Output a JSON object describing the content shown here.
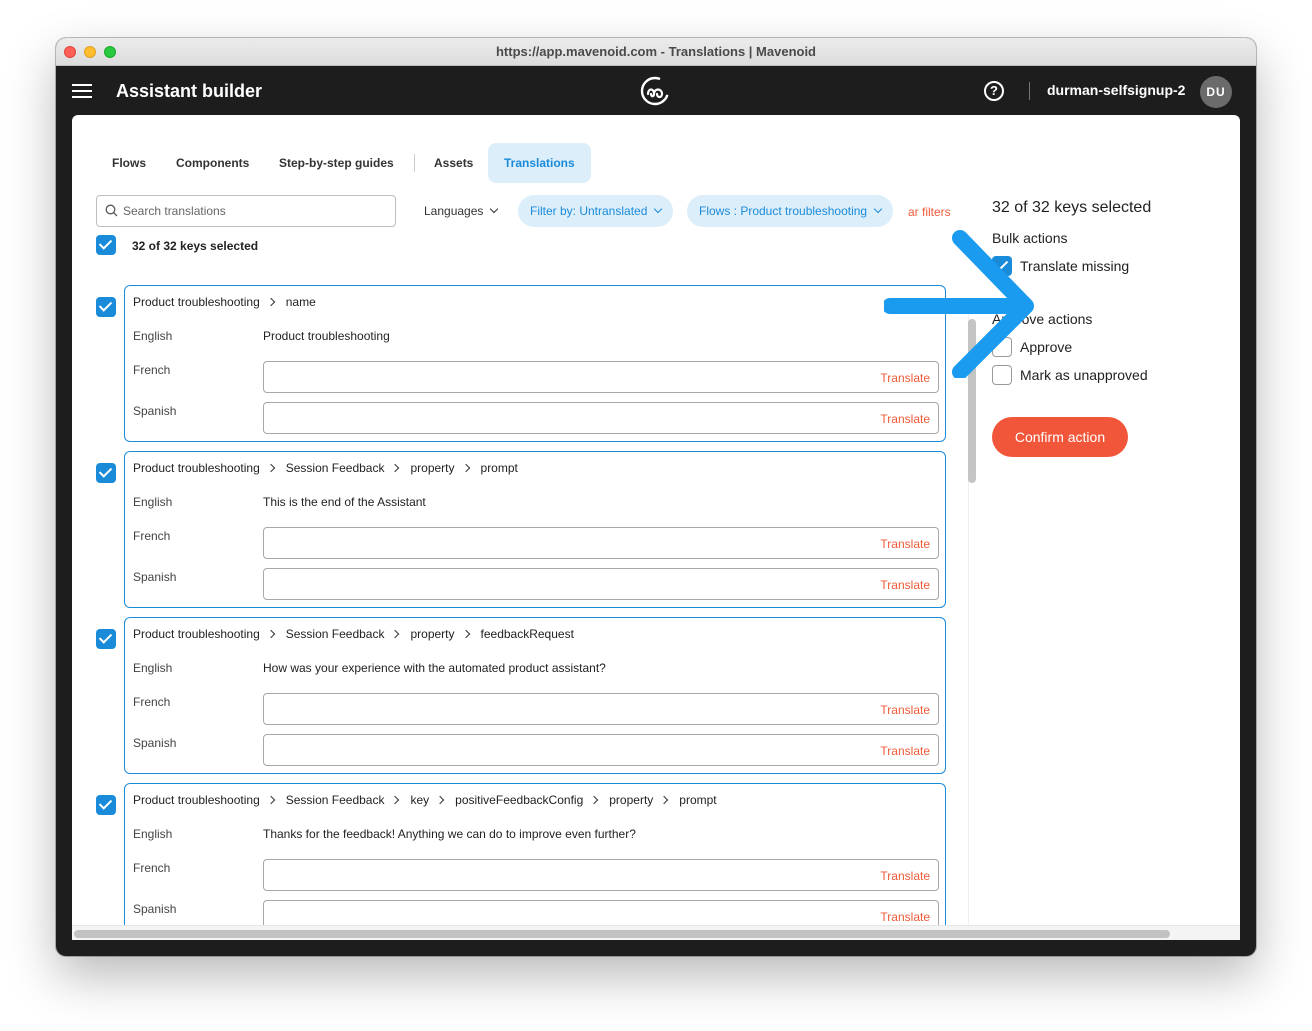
{
  "window": {
    "title": "https://app.mavenoid.com - Translations | Mavenoid"
  },
  "appbar": {
    "title": "Assistant builder",
    "username": "durman-selfsignup-2",
    "avatar_initials": "DU",
    "logo_icon": "mavenoid-logo-icon",
    "help_icon": "question-mark-icon"
  },
  "tabs": [
    {
      "label": "Flows"
    },
    {
      "label": "Components"
    },
    {
      "label": "Step-by-step guides"
    },
    {
      "label": "Assets"
    },
    {
      "label": "Translations",
      "active": true
    }
  ],
  "toolbar": {
    "search_placeholder": "Search translations",
    "languages_label": "Languages",
    "filter_label": "Filter by: Untranslated",
    "flows_label": "Flows : Product troubleshooting",
    "clear_label": "ar filters"
  },
  "selection": {
    "label": "32 of 32 keys selected",
    "all_checked": true
  },
  "items": [
    {
      "checked": true,
      "path": [
        "Product troubleshooting",
        "name"
      ],
      "english": "Product troubleshooting",
      "french": "",
      "spanish": ""
    },
    {
      "checked": true,
      "path": [
        "Product troubleshooting",
        "Session Feedback",
        "property",
        "prompt"
      ],
      "english": "This is the end of the Assistant",
      "french": "",
      "spanish": ""
    },
    {
      "checked": true,
      "path": [
        "Product troubleshooting",
        "Session Feedback",
        "property",
        "feedbackRequest"
      ],
      "english": "How was your experience with the automated product assistant?",
      "french": "",
      "spanish": ""
    },
    {
      "checked": true,
      "path": [
        "Product troubleshooting",
        "Session Feedback",
        "key",
        "positiveFeedbackConfig",
        "property",
        "prompt"
      ],
      "english": "Thanks for the feedback! Anything we can do to improve even further?",
      "french": "",
      "spanish": ""
    }
  ],
  "row_labels": {
    "english": "English",
    "french": "French",
    "spanish": "Spanish",
    "translate": "Translate"
  },
  "panel": {
    "title": "32 of 32 keys selected",
    "bulk_heading": "Bulk actions",
    "translate_missing": "Translate missing",
    "translate_missing_checked": true,
    "approve_heading": "Approve actions",
    "approve": "Approve",
    "approve_checked": false,
    "mark_unapproved": "Mark as unapproved",
    "mark_unapproved_checked": false,
    "confirm": "Confirm action"
  },
  "colors": {
    "accent": "#1a8bd9",
    "accent_bg": "#ddeefb",
    "danger": "#ef5b38",
    "confirm_bg": "#f2563a",
    "appbar_bg": "#1d1d1d",
    "arrow": "#1a9bef"
  }
}
